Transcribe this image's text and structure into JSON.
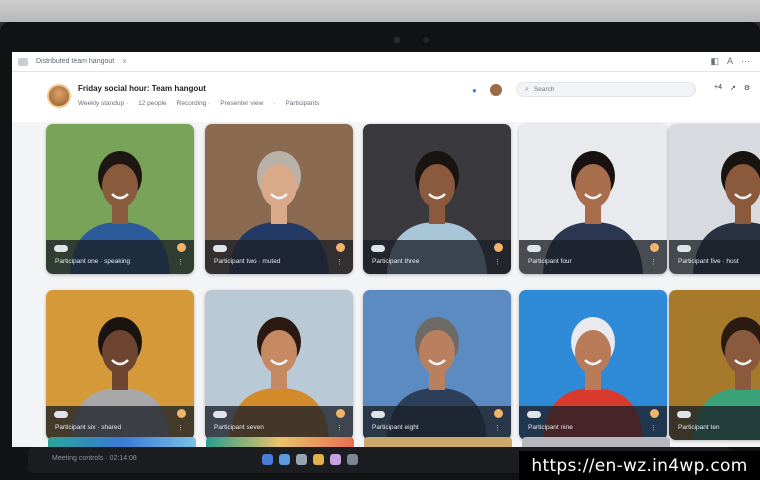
{
  "browser": {
    "tab_label": "Distributed team hangout",
    "tab_close": "×",
    "right_icons": [
      "◧",
      "A",
      "⋯"
    ]
  },
  "header": {
    "title": "Friday social hour: Team hangout",
    "meta": [
      "Weekly standup ·",
      "12 people",
      "Recording ·",
      "Presenter view",
      "·",
      "Participants"
    ],
    "search_placeholder": "Search",
    "right_count": "+4",
    "right_icons": [
      "↗",
      "⚙"
    ]
  },
  "tiles": [
    {
      "name": "participant-1",
      "caption": "Participant one · speaking",
      "bg": "#7aa35a",
      "shirt": "#2b5b9a",
      "skin": "#8a5a3c",
      "hair": "#1d1612"
    },
    {
      "name": "participant-2",
      "caption": "Participant two · muted",
      "bg": "#8b6a52",
      "shirt": "#243a66",
      "skin": "#d9a98a",
      "hair": "#b8b1a8"
    },
    {
      "name": "participant-3",
      "caption": "Participant three",
      "bg": "#3a3a3e",
      "shirt": "#a9c6d8",
      "skin": "#8b5a3e",
      "hair": "#1a1410"
    },
    {
      "name": "participant-4",
      "caption": "Participant four",
      "bg": "#e9eaee",
      "shirt": "#2b3650",
      "skin": "#a86d4c",
      "hair": "#1a1210"
    },
    {
      "name": "participant-5",
      "caption": "Participant five · host",
      "bg": "#d8dadf",
      "shirt": "#2a3140",
      "skin": "#8b5a3c",
      "hair": "#1a1410"
    },
    {
      "name": "participant-6",
      "caption": "Participant six · shared",
      "bg": "#d49a3a",
      "shirt": "#a8a8a8",
      "skin": "#6e4530",
      "hair": "#1a1410"
    },
    {
      "name": "participant-7",
      "caption": "Participant seven",
      "bg": "#b9c9d6",
      "shirt": "#d28a2a",
      "skin": "#c68a62",
      "hair": "#2a1a12"
    },
    {
      "name": "participant-8",
      "caption": "Participant eight",
      "bg": "#5b8bc0",
      "shirt": "#2c3e5a",
      "skin": "#b98060",
      "hair": "#6e6a66"
    },
    {
      "name": "participant-9",
      "caption": "Participant nine",
      "bg": "#2f8ad8",
      "shirt": "#d83a2e",
      "skin": "#b97a58",
      "hair": "#e9e9ee"
    },
    {
      "name": "participant-10",
      "caption": "Participant ten",
      "bg": "#a67a2a",
      "shirt": "#3aa37a",
      "skin": "#8b5a3c",
      "hair": "#2a1a12"
    }
  ],
  "dock": {
    "label": "Meeting controls · 02:14:08"
  },
  "watermark": "https://en-wz.in4wp.com"
}
